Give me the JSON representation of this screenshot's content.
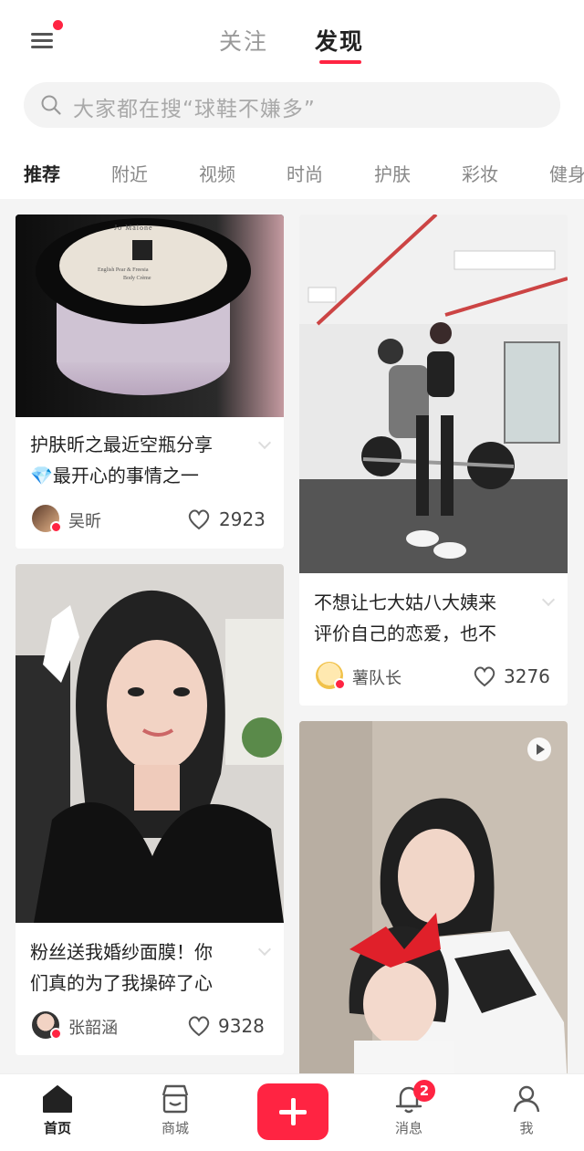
{
  "header": {
    "tabs": [
      {
        "label": "关注",
        "active": false
      },
      {
        "label": "发现",
        "active": true
      }
    ],
    "search_placeholder": "大家都在搜“球鞋不嫌多”",
    "accent_color": "#ff2442"
  },
  "categories": [
    "推荐",
    "附近",
    "视频",
    "时尚",
    "护肤",
    "彩妆",
    "健身"
  ],
  "feed": {
    "cards": [
      {
        "title_line1": "护肤昕之最近空瓶分享",
        "title_line2": "💎最开心的事情之一",
        "author": "吴昕",
        "likes": "2923",
        "image": "jo-malone-cream-jar-photo",
        "jar_label_top": "Jo Malone",
        "jar_label_mid": "English Pear & Freesia",
        "jar_label_bot": "Body Crème"
      },
      {
        "title_line1": "不想让七大姑八大姨来",
        "title_line2": "评价自己的恋爱，也不",
        "author": "薯队长",
        "likes": "3276",
        "image": "gym-couple-photo"
      },
      {
        "title_line1": "粉丝送我婚纱面膜！你",
        "title_line2": "们真的为了我操碎了心",
        "author": "张韶涵",
        "likes": "9328",
        "image": "woman-selfie-photo"
      },
      {
        "image": "mother-daughter-video-thumbnail",
        "is_video": true
      }
    ]
  },
  "bottom_nav": {
    "items": [
      {
        "label": "首页",
        "icon": "home-icon",
        "active": true
      },
      {
        "label": "商城",
        "icon": "store-icon",
        "active": false
      },
      {
        "label": "消息",
        "icon": "bell-icon",
        "active": false,
        "badge": "2"
      },
      {
        "label": "我",
        "icon": "person-icon",
        "active": false
      }
    ],
    "post_button_icon": "plus-icon"
  }
}
